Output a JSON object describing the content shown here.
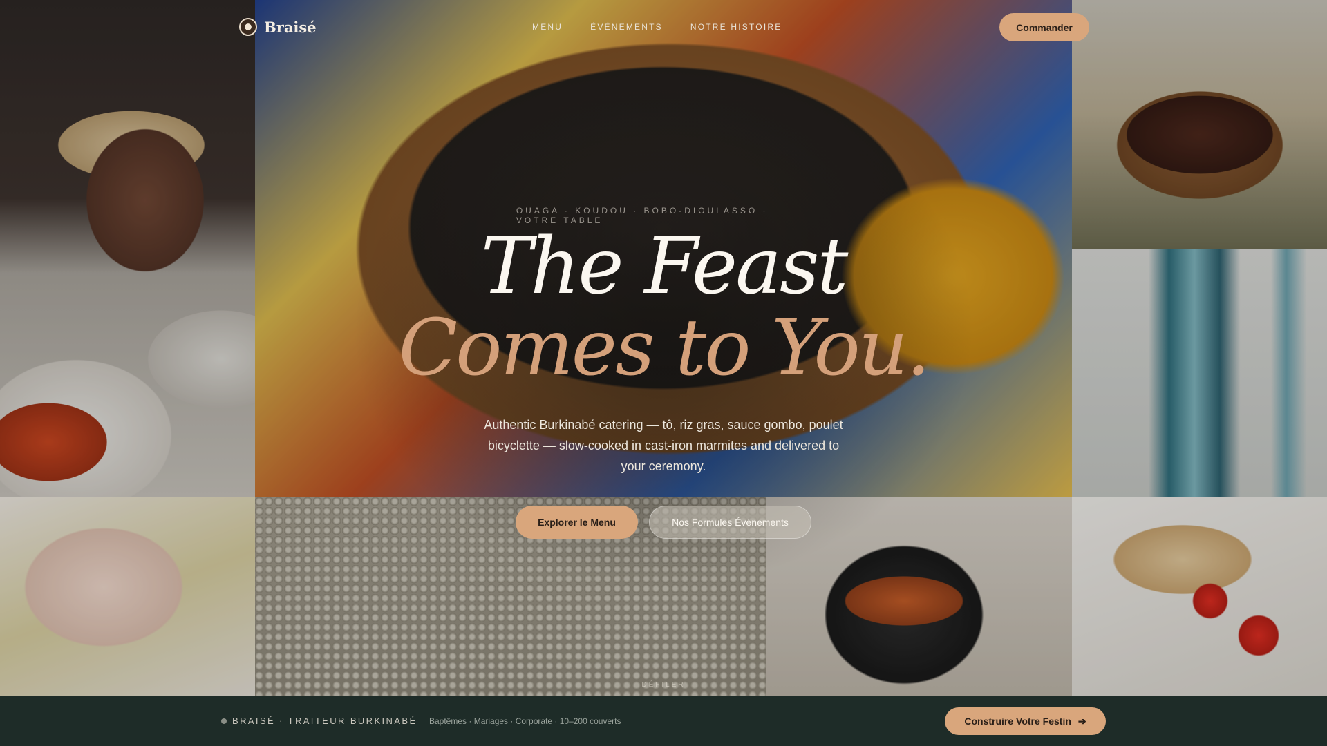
{
  "brand": {
    "name": "Braisé"
  },
  "nav": {
    "items": [
      "MENU",
      "ÉVÉNEMENTS",
      "NOTRE HISTOIRE"
    ]
  },
  "header": {
    "order_label": "Commander"
  },
  "hero": {
    "eyebrow": "OUAGA · KOUDOU · BOBO-DIOULASSO · VOTRE TABLE",
    "title_line1": "The Feast",
    "title_line2": "Comes to You.",
    "lede": "Authentic Burkinabé catering — tô, riz gras, sauce gombo, poulet bicyclette — slow-cooked in cast-iron marmites and delivered to your ceremony.",
    "cta_primary": "Explorer le Menu",
    "cta_secondary": "Nos Formules Événements",
    "scroll_label": "DÉFILER"
  },
  "footer_bar": {
    "brand_label": "BRAISÉ · TRAITEUR BURKINABÉ",
    "tags": "Baptêmes · Mariages · Corporate · 10–200 couverts",
    "build_label": "Construire Votre Festin",
    "build_icon": "arrow-right-icon"
  },
  "colors": {
    "accent": "#d9a67c",
    "bar": "#1e2c28",
    "title": "#fbf7f0",
    "title_accent": "#d4a07a"
  }
}
